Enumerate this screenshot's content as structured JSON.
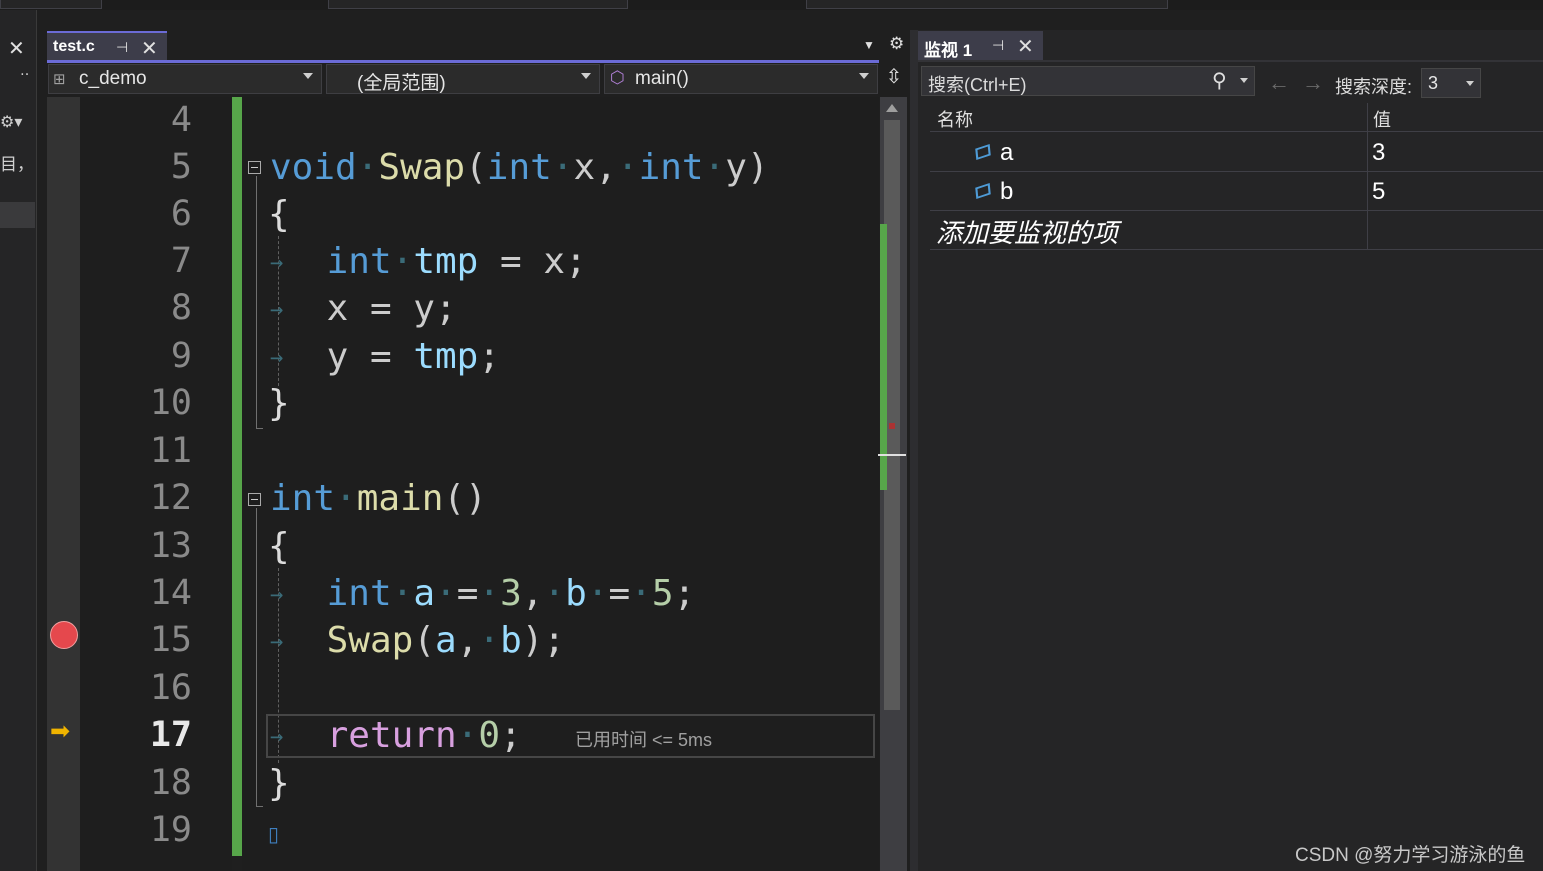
{
  "editor": {
    "tab_label": "test.c",
    "nav": {
      "project": "c_demo",
      "scope": "(全局范围)",
      "function": "main()"
    },
    "lines": [
      {
        "num": "4"
      },
      {
        "num": "5"
      },
      {
        "num": "6"
      },
      {
        "num": "7"
      },
      {
        "num": "8"
      },
      {
        "num": "9"
      },
      {
        "num": "10"
      },
      {
        "num": "11"
      },
      {
        "num": "12"
      },
      {
        "num": "13"
      },
      {
        "num": "14"
      },
      {
        "num": "15"
      },
      {
        "num": "16"
      },
      {
        "num": "17"
      },
      {
        "num": "18"
      },
      {
        "num": "19"
      }
    ],
    "code": {
      "l5": {
        "kw_void": "void",
        "fn_swap": "Swap",
        "open": "(",
        "kw_int1": "int",
        "p_x": "x",
        "comma": ",",
        "kw_int2": "int",
        "p_y": "y",
        "close": ")"
      },
      "l6": "{",
      "l7": {
        "kw": "int",
        "var": "tmp",
        "rest": "= x;"
      },
      "l8": "x = y;",
      "l9": {
        "lhs": "y =",
        "var": "tmp",
        "semi": ";"
      },
      "l10": "}",
      "l12": {
        "kw": "int",
        "fn": "main",
        "parens": "()"
      },
      "l13": "{",
      "l14": {
        "kw": "int",
        "a": "a",
        "eq1": "=",
        "three": "3",
        "comma": ",",
        "b": "b",
        "eq2": "=",
        "five": "5",
        "semi": ";"
      },
      "l15": {
        "fn": "Swap",
        "open": "(",
        "a": "a",
        "comma": ",",
        "b": "b",
        "close": ");"
      },
      "l17": {
        "kw": "return",
        "zero": "0",
        "semi": ";"
      },
      "l18": "}"
    },
    "perf_tip": "已用时间 <= 5ms"
  },
  "watch": {
    "tab_label": "监视 1",
    "search_placeholder": "搜索(Ctrl+E)",
    "depth_label": "搜索深度:",
    "depth_value": "3",
    "col_name": "名称",
    "col_value": "值",
    "rows": [
      {
        "name": "a",
        "value": "3"
      },
      {
        "name": "b",
        "value": "5"
      }
    ],
    "add_item": "添加要监视的项"
  },
  "left_panel": {
    "text": "目，"
  },
  "watermark": "CSDN @努力学习游泳的鱼",
  "colors": {
    "keyword": "#569cd6",
    "function": "#dcdcaa",
    "variable": "#9cdcfe",
    "number": "#b5cea8",
    "control": "#d8a0df",
    "change_bar": "#57a64a",
    "breakpoint": "#e5484d",
    "exec_arrow": "#f0b400",
    "tab_accent": "#6b6bd6"
  },
  "icons": [
    "close-icon",
    "pin-icon",
    "gear-icon",
    "search-icon",
    "back-arrow-icon",
    "forward-arrow-icon",
    "variable-icon",
    "breakpoint-icon",
    "execution-arrow-icon",
    "split-icon"
  ]
}
